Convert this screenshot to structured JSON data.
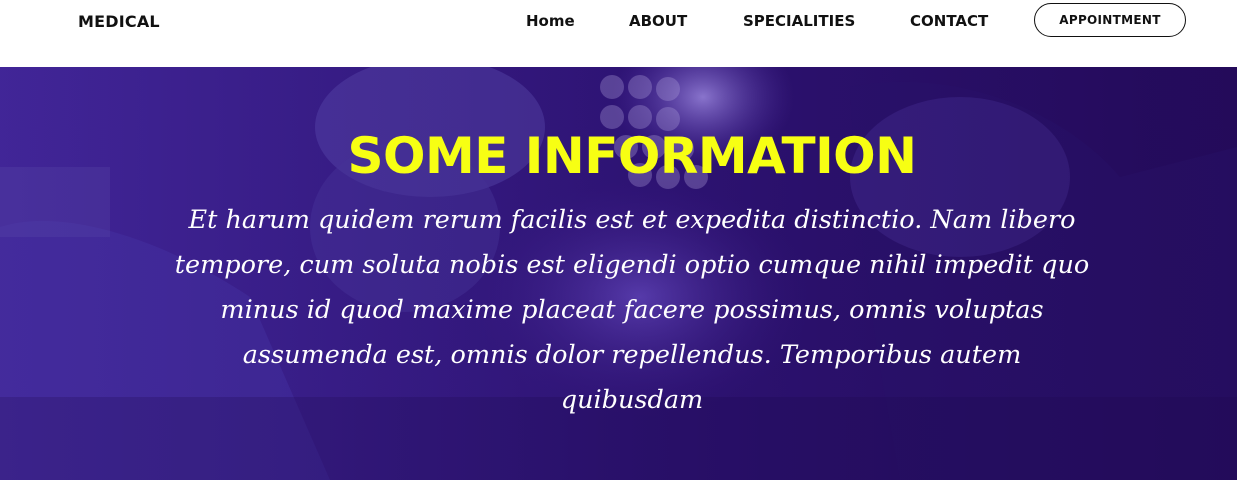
{
  "nav": {
    "brand": "MEDICAL",
    "links": [
      "Home",
      "ABOUT",
      "SPECIALITIES",
      "CONTACT"
    ],
    "cta": "APPOINTMENT"
  },
  "hero": {
    "title": "SOME INFORMATION",
    "text": "Et harum quidem rerum facilis est et expedita distinctio. Nam libero tempore, cum soluta nobis est eligendi optio cumque nihil impedit quo minus id quod maxime placeat facere possimus, omnis voluptas assumenda est, omnis dolor repellendus. Temporibus autem quibusdam",
    "background_image": "surgeons-operating-room-photo",
    "overlay_color": "#2c1060",
    "title_color": "#f7ff13"
  }
}
